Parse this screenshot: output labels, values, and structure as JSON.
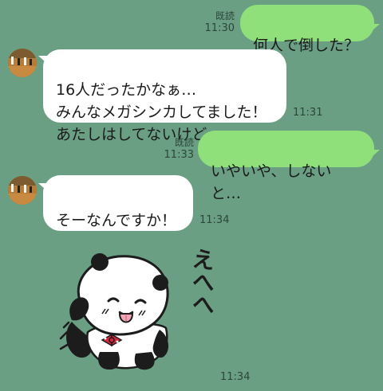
{
  "messages": [
    {
      "id": "m1",
      "direction": "outgoing",
      "text": "何人で倒した？",
      "read_label": "既読",
      "time": "11:30"
    },
    {
      "id": "m2",
      "direction": "incoming",
      "text": "16人だったかなぁ…\nみんなメガシンカしてました！\nあたしはしてないけど…",
      "time": "11:31"
    },
    {
      "id": "m3",
      "direction": "outgoing",
      "text": "いやいや、しないと…",
      "read_label": "既読",
      "time": "11:33"
    },
    {
      "id": "m4",
      "direction": "incoming",
      "text": "そーなんですか！",
      "time": "11:34"
    },
    {
      "id": "m5",
      "direction": "incoming",
      "type": "sticker",
      "sticker_text": "えへへ",
      "time": "11:34"
    }
  ],
  "colors": {
    "background": "#6a9f84",
    "outgoing_bubble": "#8fe07b",
    "incoming_bubble": "#ffffff"
  },
  "icons": {
    "avatar": "avatar-icon",
    "sticker": "panda-sticker-icon"
  }
}
